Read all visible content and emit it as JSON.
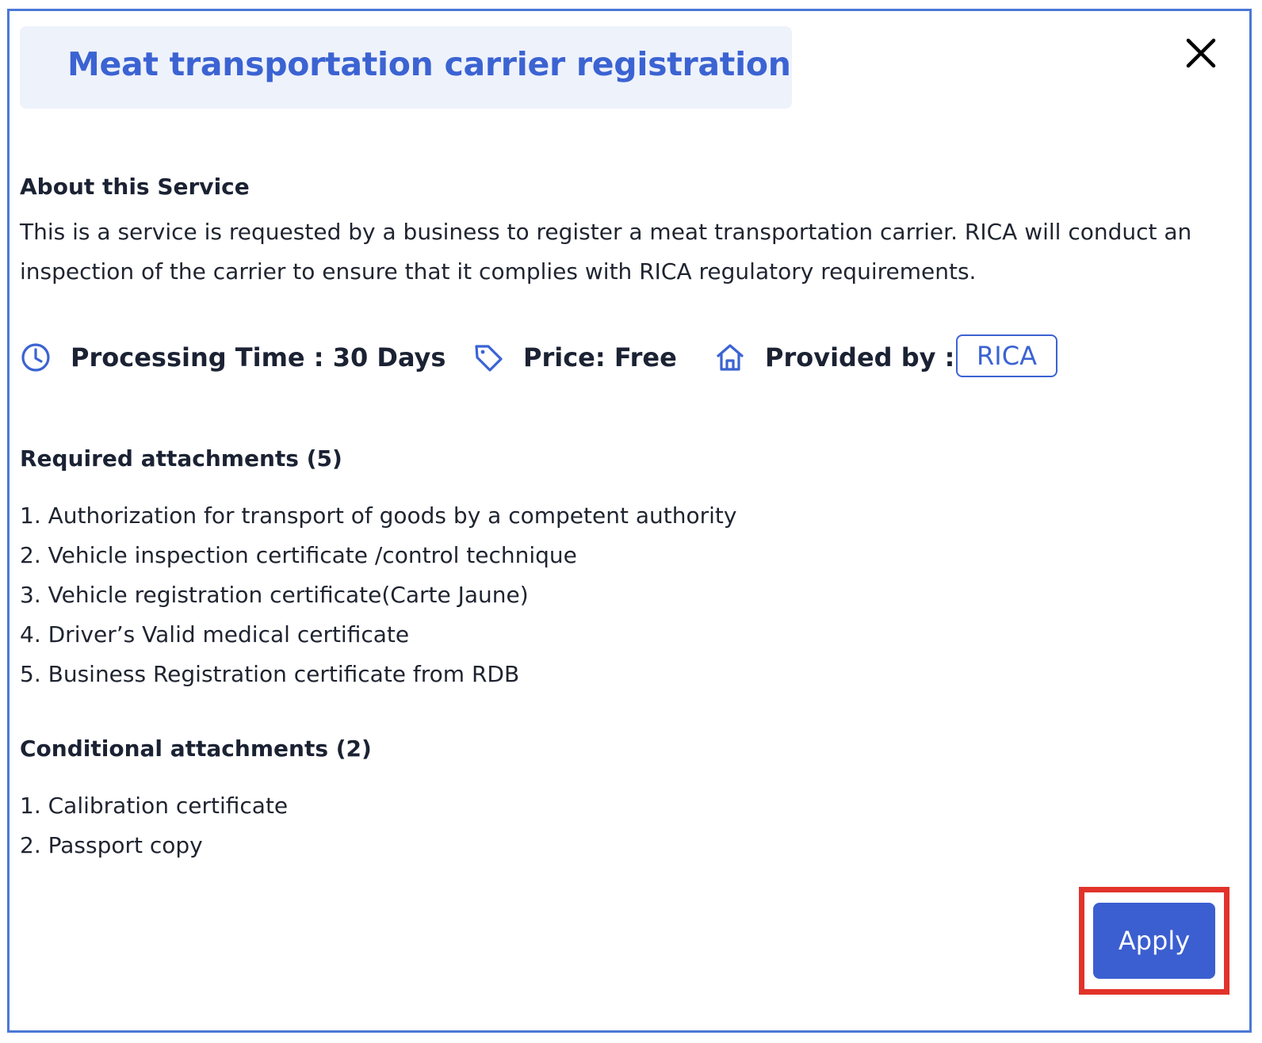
{
  "dialog": {
    "title": "Meat transportation carrier registration",
    "close_icon": "close-icon"
  },
  "about": {
    "heading": "About this Service",
    "text": "This is a service is requested by a business to register a meat transportation carrier. RICA will conduct an inspection of the carrier to ensure that it complies with RICA regulatory requirements."
  },
  "info": {
    "processing_time": "Processing Time : 30 Days",
    "processing_icon": "clock-icon",
    "price": "Price: Free",
    "price_icon": "tag-icon",
    "provided_by": "Provided by :",
    "provided_icon": "home-icon",
    "provider": "RICA"
  },
  "required": {
    "heading": "Required attachments (5)",
    "items": [
      "1. Authorization for transport of goods by a competent authority",
      "2. Vehicle inspection certificate /control technique",
      "3. Vehicle registration certificate(Carte Jaune)",
      "4. Driver’s Valid medical certificate",
      "5. Business Registration certificate from RDB"
    ]
  },
  "conditional": {
    "heading": "Conditional attachments (2)",
    "items": [
      "1. Calibration certificate",
      "2. Passport copy"
    ]
  },
  "actions": {
    "apply_label": "Apply"
  },
  "colors": {
    "accent": "#3b63d2",
    "title_bg": "#eef2fb",
    "border": "#4a78d6",
    "highlight": "#e2332a",
    "button": "#3b5fd0"
  }
}
